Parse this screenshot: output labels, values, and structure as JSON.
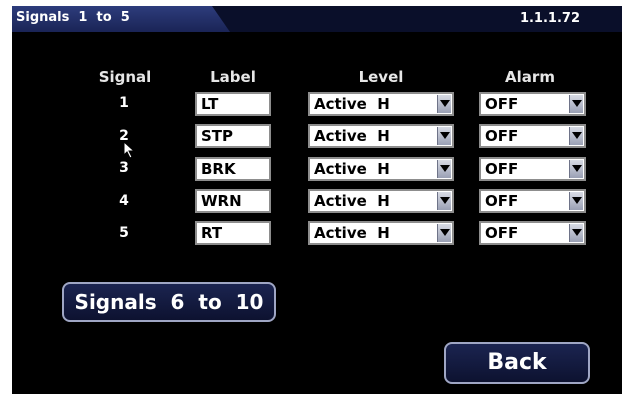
{
  "header": {
    "title": "Signals  1  to  5",
    "version": "1.1.1.72"
  },
  "columns": {
    "signal": "Signal",
    "label": "Label",
    "level": "Level",
    "alarm": "Alarm"
  },
  "rows": [
    {
      "signal": "1",
      "label": "LT",
      "level": "Active  H",
      "alarm": "OFF"
    },
    {
      "signal": "2",
      "label": "STP",
      "level": "Active  H",
      "alarm": "OFF"
    },
    {
      "signal": "3",
      "label": "BRK",
      "level": "Active  H",
      "alarm": "OFF"
    },
    {
      "signal": "4",
      "label": "WRN",
      "level": "Active  H",
      "alarm": "OFF"
    },
    {
      "signal": "5",
      "label": "RT",
      "level": "Active  H",
      "alarm": "OFF"
    }
  ],
  "buttons": {
    "next_page": "Signals  6  to  10",
    "back": "Back"
  },
  "colors": {
    "background": "#000000",
    "title_bar": "#1a2456",
    "button_bg": "#0d1230",
    "button_border": "#9fa6c4"
  },
  "icons": {
    "dropdown": "chevron-down-icon",
    "pointer": "mouse-pointer-icon"
  }
}
